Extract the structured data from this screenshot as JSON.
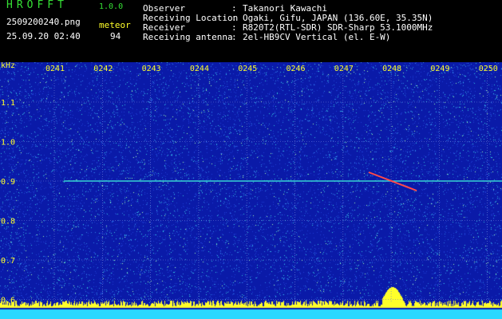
{
  "header": {
    "logo": "HROFFT",
    "version": "1.0.0",
    "filename": "2509200240.png",
    "event_label": "meteor",
    "timestamp": "25.09.20 02:40",
    "event_count": "94",
    "info": [
      {
        "label": "Observer",
        "sep": ":",
        "value": "Takanori Kawachi"
      },
      {
        "label": "Receiving Location",
        "sep": ":",
        "value": "Ogaki, Gifu, JAPAN (136.60E, 35.35N)"
      },
      {
        "label": "Receiver",
        "sep": ":",
        "value": "R820T2(RTL-SDR) SDR-Sharp 53.1000MHz"
      },
      {
        "label": "Receiving antenna",
        "sep": ":",
        "value": "2el-HB9CV Vertical (el. E-W)"
      }
    ]
  },
  "spectrogram": {
    "unit": "kHz",
    "y_ticks": [
      "1.1",
      "1.0",
      "0.9",
      "0.8",
      "0.7",
      "0.6"
    ],
    "time_ticks": [
      "0241",
      "0242",
      "0243",
      "0244",
      "0245",
      "0246",
      "0247",
      "0248",
      "0249",
      "0250"
    ],
    "carrier_khz": 0.9,
    "colors": {
      "background": "#0a1aa8",
      "grid": "#6f7fd8",
      "labels": "#ffff2a",
      "carrier": "#36d2d2",
      "noise_floor": "#2ad8ff",
      "peaks": "#ffff2a"
    }
  }
}
